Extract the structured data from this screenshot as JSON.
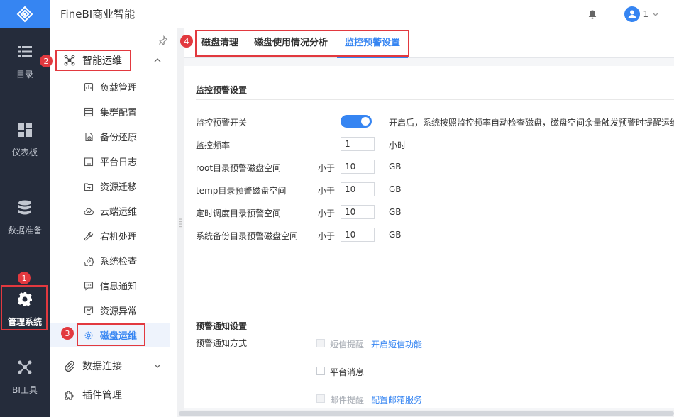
{
  "app": {
    "title": "FineBI商业智能"
  },
  "user": {
    "name": "1"
  },
  "rail": {
    "items": [
      {
        "label": "目录",
        "icon": "list-icon"
      },
      {
        "label": "仪表板",
        "icon": "dashboard-icon"
      },
      {
        "label": "数据准备",
        "icon": "database-icon"
      },
      {
        "label": "管理系统",
        "icon": "gear-icon"
      },
      {
        "label": "BI工具",
        "icon": "network-icon"
      }
    ]
  },
  "sidebar": {
    "group_ops": "智能运维",
    "items": [
      "负载管理",
      "集群配置",
      "备份还原",
      "平台日志",
      "资源迁移",
      "云端运维",
      "宕机处理",
      "系统检查",
      "信息通知",
      "资源异常",
      "磁盘运维"
    ],
    "group_data": "数据连接",
    "group_plugin": "插件管理"
  },
  "badges": [
    "1",
    "2",
    "3",
    "4"
  ],
  "tabs": [
    "磁盘清理",
    "磁盘使用情况分析",
    "监控预警设置"
  ],
  "monitor": {
    "section_title": "监控预警设置",
    "switch_label": "监控预警开关",
    "switch_desc": "开启后，系统按照监控频率自动检查磁盘，磁盘空间余量触发预警时提醒运维",
    "freq_label": "监控频率",
    "freq_value": "1",
    "freq_unit": "小时",
    "less_than": "小于",
    "unit_gb": "GB",
    "rows": [
      {
        "label": "root目录预警磁盘空间",
        "value": "10"
      },
      {
        "label": "temp目录预警磁盘空间",
        "value": "10"
      },
      {
        "label": "定时调度目录预警空间",
        "value": "10"
      },
      {
        "label": "系统备份目录预警磁盘空间",
        "value": "10"
      }
    ]
  },
  "notify": {
    "section_title": "预警通知设置",
    "method_label": "预警通知方式",
    "sms_label": "短信提醒",
    "sms_link": "开启短信功能",
    "platform_label": "平台消息",
    "mail_label": "邮件提醒",
    "mail_link": "配置邮箱服务"
  },
  "colors": {
    "accent": "#3685f2",
    "rail": "#252c3b",
    "highlight": "#e2393f"
  }
}
